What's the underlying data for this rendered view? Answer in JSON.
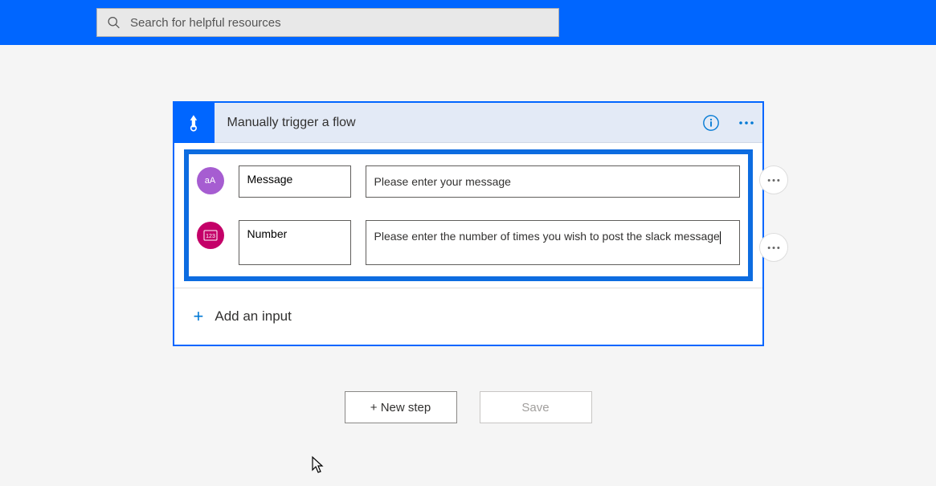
{
  "search": {
    "placeholder": "Search for helpful resources"
  },
  "trigger": {
    "title": "Manually trigger a flow",
    "inputs": [
      {
        "typeLabel": "aA",
        "name": "Message",
        "description": "Please enter your message"
      },
      {
        "typeLabel": "123",
        "name": "Number",
        "description": "Please enter the number of times you wish to post the slack message"
      }
    ],
    "addInputLabel": "Add an input"
  },
  "actions": {
    "newStep": "+ New step",
    "save": "Save"
  }
}
